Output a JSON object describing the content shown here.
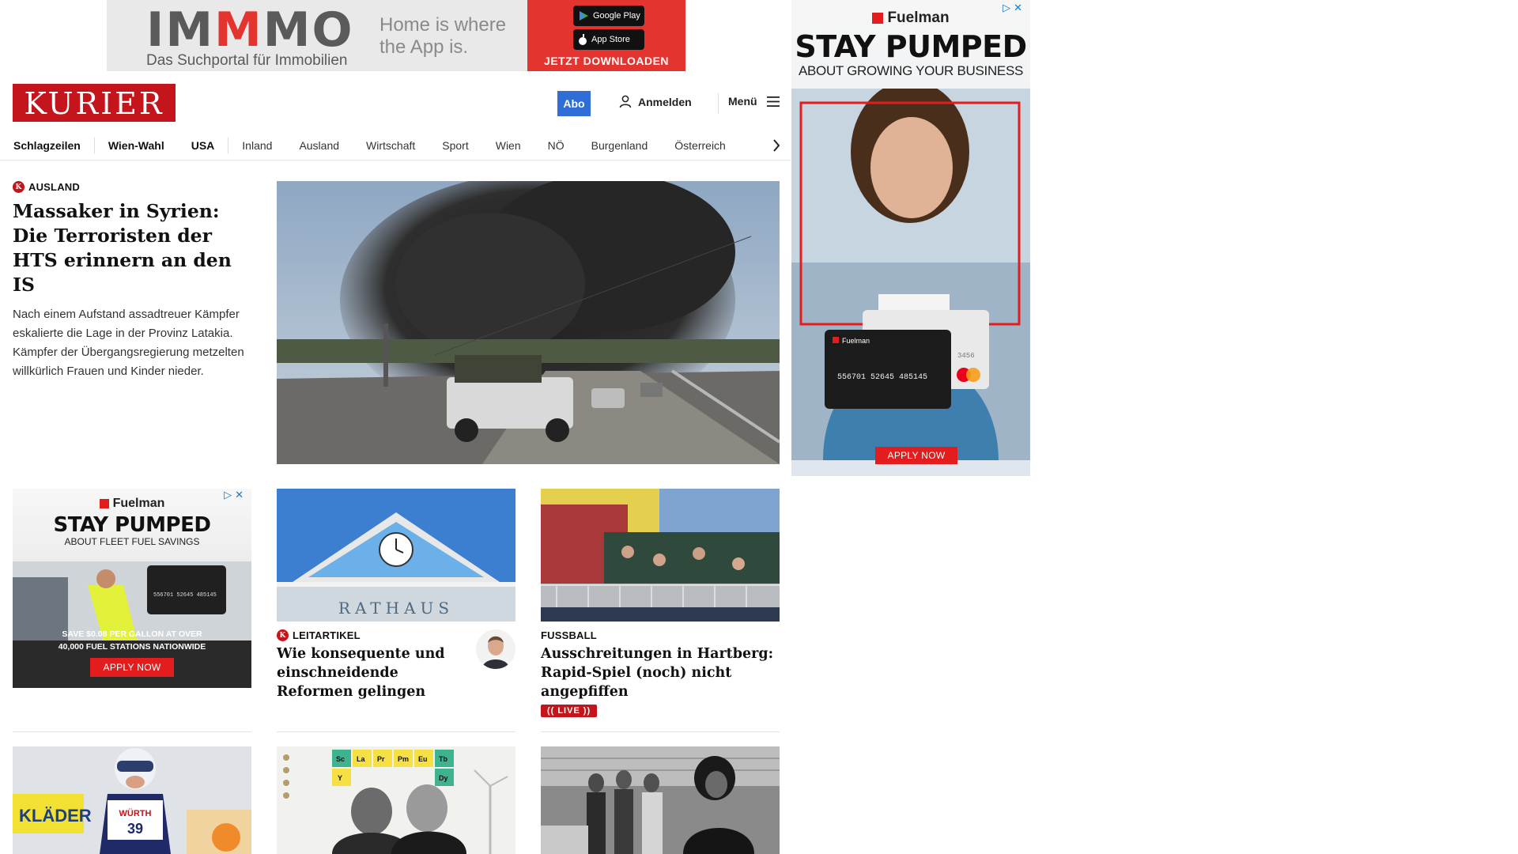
{
  "top_ad": {
    "logo_part1": "IM",
    "logo_part2": "M",
    "logo_part3": "MO",
    "subtitle": "Das Suchportal für Immobilien",
    "claim": "Home is where the App is.",
    "google_play": "Google Play",
    "app_store": "App Store",
    "cta": "JETZT DOWNLOADEN"
  },
  "header": {
    "brand": "KURIER",
    "abo_label": "Abo",
    "login_label": "Anmelden",
    "menu_label": "Menü"
  },
  "nav": {
    "items": [
      "Schlagzeilen",
      "Wien-Wahl",
      "USA",
      "Inland",
      "Ausland",
      "Wirtschaft",
      "Sport",
      "Wien",
      "NÖ",
      "Burgenland",
      "Österreich"
    ]
  },
  "lead": {
    "kicker": "AUSLAND",
    "title": "Massaker in Syrien: Die Terroristen der HTS erinnern an den IS",
    "teaser": "Nach einem Aufstand assadtreuer Kämpfer eskalierte die Lage in der Provinz Latakia. Kämpfer der Übergangsregierung metzelten willkürlich Frauen und Kinder nieder."
  },
  "side_ad": {
    "brand": "Fuelman",
    "headline": "STAY PUMPED",
    "sub": "ABOUT GROWING YOUR BUSINESS",
    "card_number": "556701 52645 485145",
    "card_tail": "3456",
    "cta": "APPLY NOW"
  },
  "small_ad": {
    "brand": "Fuelman",
    "headline": "STAY PUMPED",
    "sub": "ABOUT FLEET FUEL SAVINGS",
    "offer_line1": "SAVE $0.08 PER GALLON AT OVER",
    "offer_line2": "40,000 FUEL STATIONS NATIONWIDE",
    "cta": "APPLY NOW"
  },
  "cards": {
    "leitartikel": {
      "kicker": "LEITARTIKEL",
      "title": "Wie konsequente und einschneidende Reformen gelingen",
      "sign": "RATHAUS"
    },
    "fussball": {
      "kicker": "FUSSBALL",
      "title": "Ausschreitungen in Hartberg: Rapid-Spiel (noch) nicht angepfiffen",
      "live": "LIVE"
    }
  },
  "row3": {
    "sport_bib": "39",
    "sport_sponsor": "WÜRTH",
    "sport_banner": "KLÄDER",
    "elements": [
      "Sc",
      "La",
      "Pr",
      "Pm",
      "Eu",
      "Tb",
      "Y",
      "Dy"
    ]
  }
}
